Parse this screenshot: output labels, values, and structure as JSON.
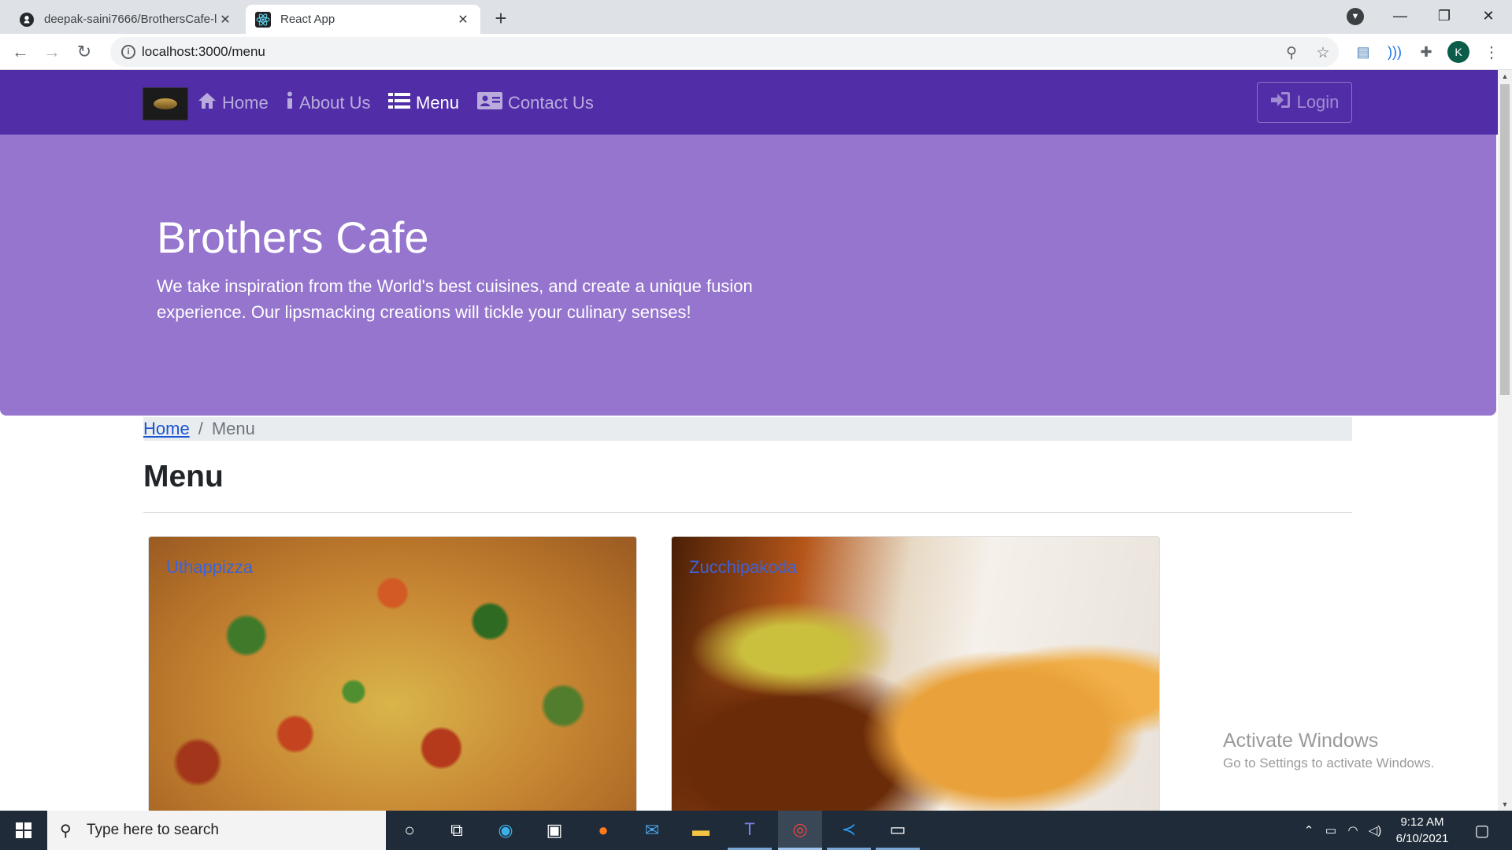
{
  "browser": {
    "tabs": [
      {
        "title": "deepak-saini7666/BrothersCafe-l",
        "icon": "github-icon",
        "active": false
      },
      {
        "title": "React App",
        "icon": "react-icon",
        "active": true
      }
    ],
    "url": "localhost:3000/menu",
    "profile_initial": "K"
  },
  "navbar": {
    "links": [
      {
        "label": "Home",
        "icon": "home-icon"
      },
      {
        "label": "About Us",
        "icon": "info-icon"
      },
      {
        "label": "Menu",
        "icon": "list-icon",
        "active": true
      },
      {
        "label": "Contact Us",
        "icon": "address-card-icon"
      }
    ],
    "login_label": "Login"
  },
  "jumbotron": {
    "title": "Brothers Cafe",
    "text": "We take inspiration from the World's best cuisines, and create a unique fusion experience. Our lipsmacking creations will tickle your culinary senses!"
  },
  "breadcrumb": {
    "home": "Home",
    "separator": "/",
    "current": "Menu"
  },
  "menu": {
    "heading": "Menu",
    "dishes": [
      {
        "name": "Uthappizza"
      },
      {
        "name": "Zucchipakoda"
      }
    ]
  },
  "watermark": {
    "title": "Activate Windows",
    "subtitle": "Go to Settings to activate Windows."
  },
  "taskbar": {
    "search_placeholder": "Type here to search",
    "time": "9:12 AM",
    "date": "6/10/2021"
  },
  "colors": {
    "navbar": "#512da8",
    "jumbotron": "#9575cd",
    "link": "#1a55d6"
  }
}
